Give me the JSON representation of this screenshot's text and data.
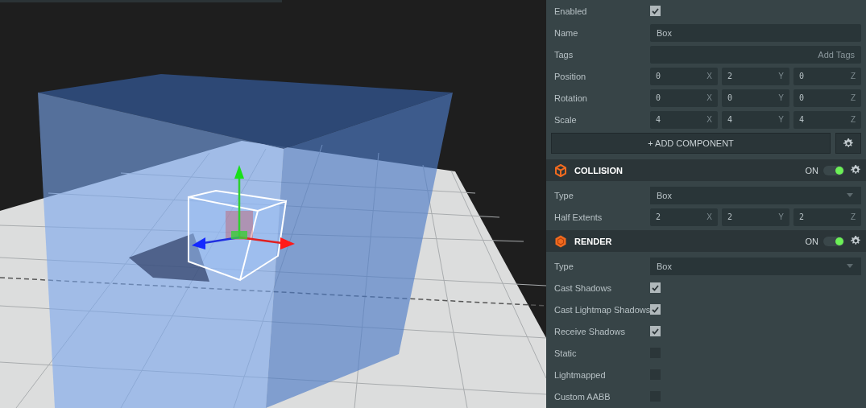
{
  "entity": {
    "properties": [
      {
        "kind": "checkbox",
        "label": "Enabled",
        "checked": true
      },
      {
        "kind": "text",
        "label": "Name",
        "value": "Box"
      },
      {
        "kind": "text",
        "label": "Tags",
        "placeholder": "Add Tags"
      },
      {
        "kind": "vector",
        "label": "Position",
        "values": [
          {
            "value": "0",
            "axis": "X"
          },
          {
            "value": "2",
            "axis": "Y"
          },
          {
            "value": "0",
            "axis": "Z"
          }
        ]
      },
      {
        "kind": "vector",
        "label": "Rotation",
        "values": [
          {
            "value": "0",
            "axis": "X"
          },
          {
            "value": "0",
            "axis": "Y"
          },
          {
            "value": "0",
            "axis": "Z"
          }
        ]
      },
      {
        "kind": "vector",
        "label": "Scale",
        "values": [
          {
            "value": "4",
            "axis": "X"
          },
          {
            "value": "4",
            "axis": "Y"
          },
          {
            "value": "4",
            "axis": "Z"
          }
        ]
      }
    ]
  },
  "add_component": {
    "label": "+ ADD COMPONENT"
  },
  "components": [
    {
      "kind": "collision",
      "title": "COLLISION",
      "toggle_label": "ON",
      "on": true,
      "properties": [
        {
          "kind": "select",
          "label": "Type",
          "value": "Box"
        },
        {
          "kind": "vector",
          "label": "Half Extents",
          "values": [
            {
              "value": "2",
              "axis": "X"
            },
            {
              "value": "2",
              "axis": "Y"
            },
            {
              "value": "2",
              "axis": "Z"
            }
          ]
        }
      ]
    },
    {
      "kind": "render",
      "title": "RENDER",
      "toggle_label": "ON",
      "on": true,
      "properties": [
        {
          "kind": "select",
          "label": "Type",
          "value": "Box"
        },
        {
          "kind": "checkbox",
          "label": "Cast Shadows",
          "checked": true
        },
        {
          "kind": "checkbox",
          "label": "Cast Lightmap Shadows",
          "checked": true
        },
        {
          "kind": "checkbox",
          "label": "Receive Shadows",
          "checked": true
        },
        {
          "kind": "checkbox",
          "label": "Static",
          "checked": false
        },
        {
          "kind": "checkbox",
          "label": "Lightmapped",
          "checked": false
        },
        {
          "kind": "checkbox",
          "label": "Custom AABB",
          "checked": false
        }
      ]
    }
  ]
}
